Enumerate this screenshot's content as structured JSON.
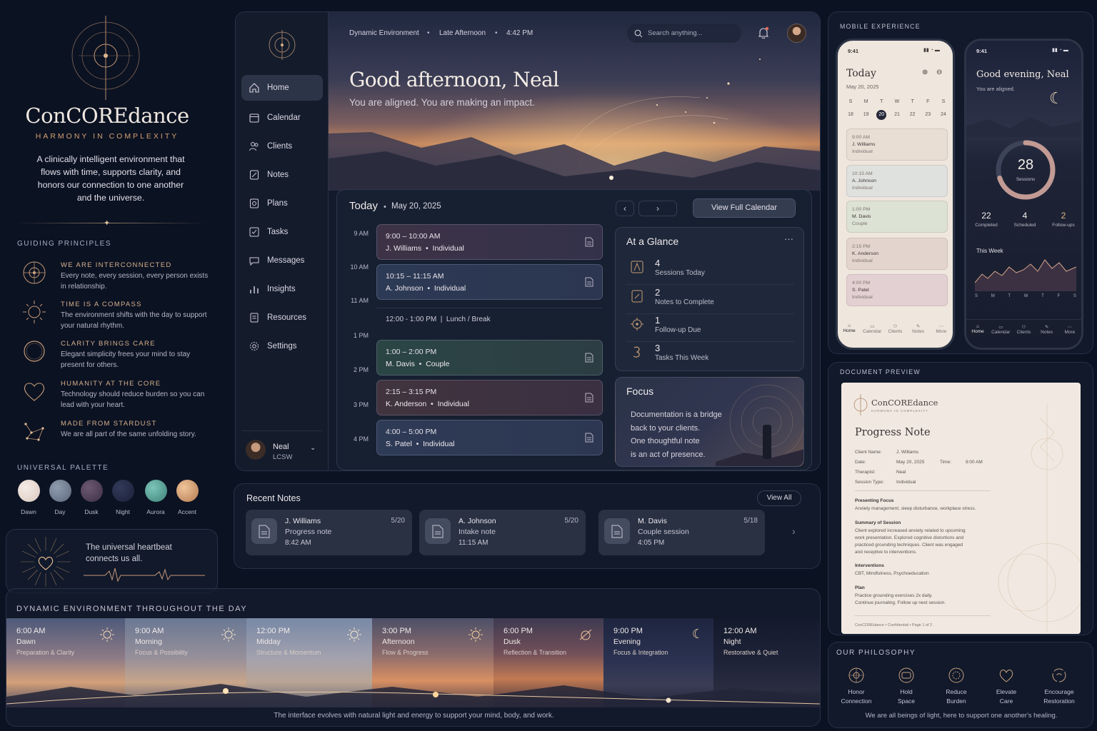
{
  "brand": {
    "name": "ConCOREdance",
    "tagline": "HARMONY IN COMPLEXITY",
    "description": "A clinically intelligent environment that flows with time, supports clarity, and honors our connection to one another and the universe."
  },
  "principles": {
    "heading": "GUIDING PRINCIPLES",
    "items": [
      {
        "title": "WE ARE INTERCONNECTED",
        "text": "Every note, every session, every person exists in relationship.",
        "icon": "network-icon"
      },
      {
        "title": "TIME IS A COMPASS",
        "text": "The environment shifts with the day to support your natural rhythm.",
        "icon": "sun-compass-icon"
      },
      {
        "title": "CLARITY BRINGS CARE",
        "text": "Elegant simplicity frees your mind to stay present for others.",
        "icon": "ring-icon"
      },
      {
        "title": "HUMANITY AT THE CORE",
        "text": "Technology should reduce burden so you can lead with your heart.",
        "icon": "heart-icon"
      },
      {
        "title": "MADE FROM STARDUST",
        "text": "We are all part of the same unfolding story.",
        "icon": "constellation-icon"
      }
    ]
  },
  "palette": {
    "heading": "UNIVERSAL PALETTE",
    "swatches": [
      {
        "name": "Dawn",
        "color": "#e7d9d0"
      },
      {
        "name": "Day",
        "color": "#707c91"
      },
      {
        "name": "Dusk",
        "color": "#4b3c52"
      },
      {
        "name": "Night",
        "color": "#202743"
      },
      {
        "name": "Aurora",
        "color": "#4f9a92"
      },
      {
        "name": "Accent",
        "color": "#d49a6a"
      }
    ]
  },
  "heartbeat": {
    "text": "The universal heartbeat connects us all."
  },
  "app": {
    "topbar": {
      "env": "Dynamic Environment",
      "phase": "Late Afternoon",
      "time": "4:42 PM",
      "search_placeholder": "Search anything..."
    },
    "nav": [
      {
        "label": "Home",
        "icon": "home-icon"
      },
      {
        "label": "Calendar",
        "icon": "calendar-icon"
      },
      {
        "label": "Clients",
        "icon": "clients-icon"
      },
      {
        "label": "Notes",
        "icon": "notes-icon"
      },
      {
        "label": "Plans",
        "icon": "plans-icon"
      },
      {
        "label": "Tasks",
        "icon": "tasks-icon"
      },
      {
        "label": "Messages",
        "icon": "messages-icon"
      },
      {
        "label": "Insights",
        "icon": "insights-icon"
      },
      {
        "label": "Resources",
        "icon": "resources-icon"
      },
      {
        "label": "Settings",
        "icon": "settings-icon"
      }
    ],
    "user": {
      "name": "Neal",
      "role": "LCSW"
    },
    "greeting": "Good afternoon, Neal",
    "greeting_sub": "You are aligned. You are making an impact.",
    "schedule": {
      "title": "Today",
      "date": "May 20, 2025",
      "view_button": "View Full Calendar",
      "times": [
        "9 AM",
        "10 AM",
        "11 AM",
        "1 PM",
        "2 PM",
        "3 PM",
        "4 PM"
      ],
      "appointments": [
        {
          "time": "9:00 – 10:00 AM",
          "client": "J. Williams",
          "type": "Individual"
        },
        {
          "time": "10:15 – 11:15 AM",
          "client": "A. Johnson",
          "type": "Individual"
        },
        {
          "time": "1:00 – 2:00 PM",
          "client": "M. Davis",
          "type": "Couple"
        },
        {
          "time": "2:15 – 3:15 PM",
          "client": "K. Anderson",
          "type": "Individual"
        },
        {
          "time": "4:00 – 5:00 PM",
          "client": "S. Patel",
          "type": "Individual"
        }
      ],
      "lunch": {
        "time": "12:00 - 1:00 PM",
        "label": "Lunch / Break"
      }
    },
    "glance": {
      "title": "At a Glance",
      "items": [
        {
          "value": "4",
          "label": "Sessions Today"
        },
        {
          "value": "2",
          "label": "Notes to Complete"
        },
        {
          "value": "1",
          "label": "Follow-up Due"
        },
        {
          "value": "3",
          "label": "Tasks This Week"
        }
      ]
    },
    "focus": {
      "title": "Focus",
      "lines": [
        "Documentation is a bridge",
        "back to your clients.",
        "One thoughtful note",
        "is an act of presence."
      ]
    }
  },
  "recent_notes": {
    "title": "Recent Notes",
    "view_all": "View All",
    "items": [
      {
        "client": "J. Williams",
        "type": "Progress note",
        "time": "8:42 AM",
        "date": "5/20"
      },
      {
        "client": "A. Johnson",
        "type": "Intake note",
        "time": "11:15 AM",
        "date": "5/20"
      },
      {
        "client": "M. Davis",
        "type": "Couple session",
        "time": "4:05 PM",
        "date": "5/18"
      }
    ]
  },
  "timeline": {
    "heading": "DYNAMIC ENVIRONMENT THROUGHOUT THE DAY",
    "caption": "The interface evolves with natural light and energy to support your mind, body, and work.",
    "phases": [
      {
        "time": "6:00 AM",
        "name": "Dawn",
        "desc": "Preparation & Clarity"
      },
      {
        "time": "9:00 AM",
        "name": "Morning",
        "desc": "Focus & Possibility"
      },
      {
        "time": "12:00 PM",
        "name": "Midday",
        "desc": "Structure & Momentum"
      },
      {
        "time": "3:00 PM",
        "name": "Afternoon",
        "desc": "Flow & Progress"
      },
      {
        "time": "6:00 PM",
        "name": "Dusk",
        "desc": "Reflection & Transition"
      },
      {
        "time": "9:00 PM",
        "name": "Evening",
        "desc": "Focus & Integration"
      },
      {
        "time": "12:00 AM",
        "name": "Night",
        "desc": "Restorative & Quiet"
      }
    ]
  },
  "mobile": {
    "heading": "MOBILE EXPERIENCE",
    "phone1": {
      "status_time": "9:41",
      "title": "Today",
      "date": "May 20, 2025",
      "weekdays": [
        "S",
        "M",
        "T",
        "W",
        "T",
        "F",
        "S"
      ],
      "days": [
        "18",
        "19",
        "20",
        "21",
        "22",
        "23",
        "24"
      ],
      "appts": [
        {
          "time": "9:00 AM",
          "client": "J. Williams",
          "type": "Individual"
        },
        {
          "time": "10:15 AM",
          "client": "A. Johnson",
          "type": "Individual"
        },
        {
          "time": "1:00 PM",
          "client": "M. Davis",
          "type": "Couple"
        },
        {
          "time": "2:15 PM",
          "client": "K. Anderson",
          "type": "Individual"
        },
        {
          "time": "4:00 PM",
          "client": "S. Patel",
          "type": "Individual"
        }
      ],
      "tabs": [
        "Home",
        "Calendar",
        "Clients",
        "Notes",
        "More"
      ]
    },
    "phone2": {
      "status_time": "9:41",
      "title": "Good evening, Neal",
      "sub": "You are aligned.",
      "ring_value": "28",
      "ring_label": "Sessions",
      "ring_fraction": 0.7,
      "stats": [
        {
          "value": "22",
          "label": "Completed"
        },
        {
          "value": "4",
          "label": "Scheduled"
        },
        {
          "value": "2",
          "label": "Follow-ups"
        }
      ],
      "week_title": "This Week",
      "week_days": [
        "S",
        "M",
        "T",
        "W",
        "T",
        "F",
        "S"
      ],
      "tabs": [
        "Home",
        "Calendar",
        "Clients",
        "Notes",
        "More"
      ]
    }
  },
  "document": {
    "heading": "DOCUMENT PREVIEW",
    "brand": "ConCOREdance",
    "brand_tag": "HARMONY IN COMPLEXITY",
    "title": "Progress Note",
    "fields": {
      "client_label": "Client Name:",
      "client": "J. Williams",
      "date_label": "Date:",
      "date": "May 20, 2025",
      "time_label": "Time:",
      "time": "9:00 AM",
      "therapist_label": "Therapist:",
      "therapist": "Neal",
      "type_label": "Session Type:",
      "type": "Individual"
    },
    "sections": [
      {
        "h": "Presenting Focus",
        "t": [
          "Anxiety management, sleep disturbance,  workplace stress."
        ]
      },
      {
        "h": "Summary of Session",
        "t": [
          "Client explored increased anxiety related to upcoming",
          "work presentation. Explored cognitive distortions and",
          "practiced grounding techniques. Client was engaged",
          "and receptive to interventions."
        ]
      },
      {
        "h": "Interventions",
        "t": [
          "CBT, Mindfulness, Psychoeducation"
        ]
      },
      {
        "h": "Plan",
        "t": [
          "Practice grounding exercises 2x daily.",
          "Continue journaling. Follow up next session."
        ]
      }
    ],
    "footer": "ConCOREdance  •  Confidential  •  Page 1 of 2"
  },
  "philosophy": {
    "heading": "OUR PHILOSOPHY",
    "items": [
      {
        "l1": "Honor",
        "l2": "Connection"
      },
      {
        "l1": "Hold",
        "l2": "Space"
      },
      {
        "l1": "Reduce",
        "l2": "Burden"
      },
      {
        "l1": "Elevate",
        "l2": "Care"
      },
      {
        "l1": "Encourage",
        "l2": "Restoration"
      }
    ],
    "caption": "We are all beings of light, here to support one another's healing."
  }
}
